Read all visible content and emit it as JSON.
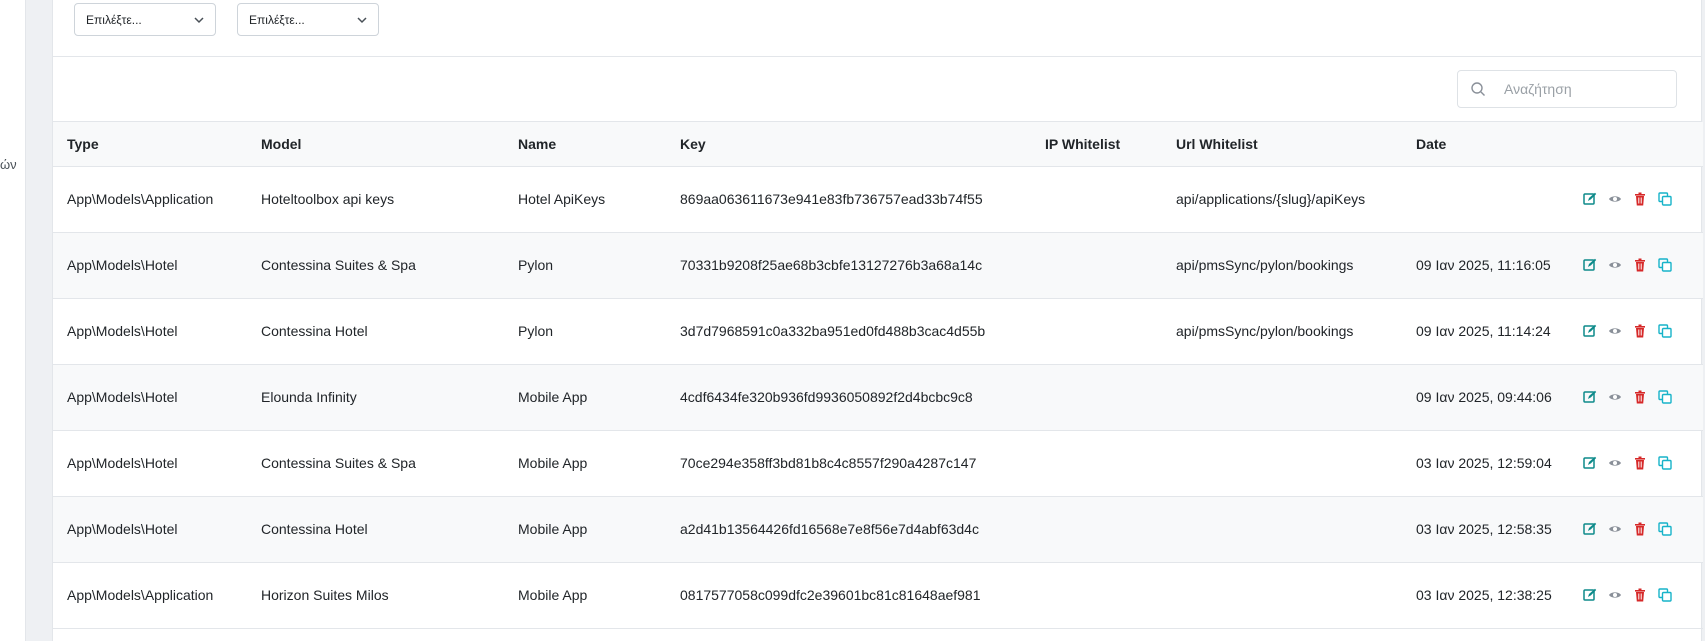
{
  "sidebar": {
    "fragment": "ών"
  },
  "filters": {
    "select1": {
      "value": "Επιλέξτε..."
    },
    "select2": {
      "value": "Επιλέξτε..."
    }
  },
  "search": {
    "placeholder": "Αναζήτηση"
  },
  "table": {
    "headers": {
      "type": "Type",
      "model": "Model",
      "name": "Name",
      "key": "Key",
      "ip_whitelist": "IP Whitelist",
      "url_whitelist": "Url Whitelist",
      "date": "Date"
    },
    "rows": [
      {
        "type": "App\\Models\\Application",
        "model": "Hoteltoolbox api keys",
        "name": "Hotel ApiKeys",
        "key": "869aa063611673e941e83fb736757ead33b74f55",
        "ip": "",
        "url": "api/applications/{slug}/apiKeys",
        "date": ""
      },
      {
        "type": "App\\Models\\Hotel",
        "model": "Contessina Suites & Spa",
        "name": "Pylon",
        "key": "70331b9208f25ae68b3cbfe13127276b3a68a14c",
        "ip": "",
        "url": "api/pmsSync/pylon/bookings",
        "date": "09 Ιαν 2025, 11:16:05"
      },
      {
        "type": "App\\Models\\Hotel",
        "model": "Contessina Hotel",
        "name": "Pylon",
        "key": "3d7d7968591c0a332ba951ed0fd488b3cac4d55b",
        "ip": "",
        "url": "api/pmsSync/pylon/bookings",
        "date": "09 Ιαν 2025, 11:14:24"
      },
      {
        "type": "App\\Models\\Hotel",
        "model": "Elounda Infinity",
        "name": "Mobile App",
        "key": "4cdf6434fe320b936fd9936050892f2d4bcbc9c8",
        "ip": "",
        "url": "",
        "date": "09 Ιαν 2025, 09:44:06"
      },
      {
        "type": "App\\Models\\Hotel",
        "model": "Contessina Suites & Spa",
        "name": "Mobile App",
        "key": "70ce294e358ff3bd81b8c4c8557f290a4287c147",
        "ip": "",
        "url": "",
        "date": "03 Ιαν 2025, 12:59:04"
      },
      {
        "type": "App\\Models\\Hotel",
        "model": "Contessina Hotel",
        "name": "Mobile App",
        "key": "a2d41b13564426fd16568e7e8f56e7d4abf63d4c",
        "ip": "",
        "url": "",
        "date": "03 Ιαν 2025, 12:58:35"
      },
      {
        "type": "App\\Models\\Application",
        "model": "Horizon Suites Milos",
        "name": "Mobile App",
        "key": "0817577058c099dfc2e39601bc81c81648aef981",
        "ip": "",
        "url": "",
        "date": "03 Ιαν 2025, 12:38:25"
      }
    ]
  },
  "actions": [
    {
      "icon": "edit-icon",
      "color": "#0d8a8a"
    },
    {
      "icon": "eye-icon",
      "color": "#8a9099"
    },
    {
      "icon": "trash-icon",
      "color": "#d62828"
    },
    {
      "icon": "copy-icon",
      "color": "#17b3c9"
    }
  ]
}
